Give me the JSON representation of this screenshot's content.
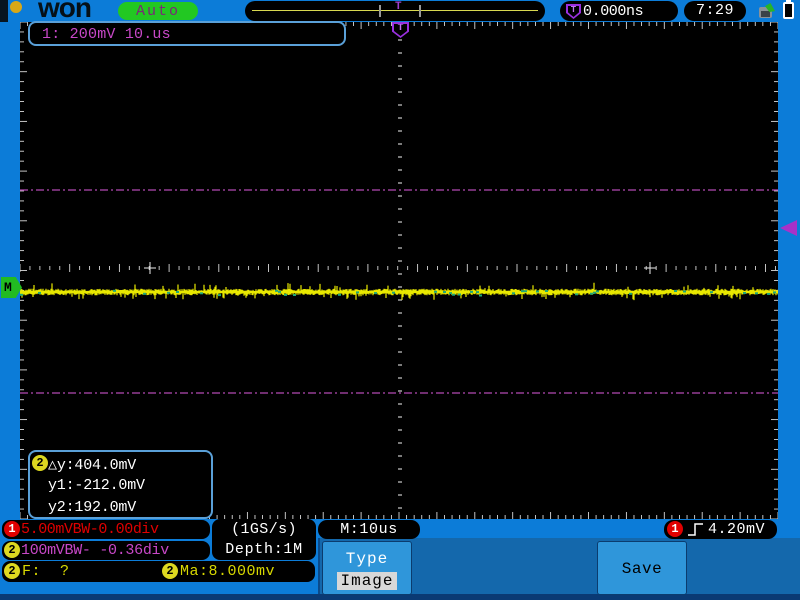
{
  "top_bar": {
    "logo_text": "won",
    "mode": "Auto",
    "trigger_marker": "T",
    "trigger_offset": "0.000ns",
    "clock": "7:29"
  },
  "grid": {
    "channel_info": "1: 200mV 10.us",
    "trigger_marker": "T",
    "math_marker": "M"
  },
  "cursor_measure": {
    "channel_badge": "2",
    "delta_y": "△y:404.0mV",
    "y1": "y1:-212.0mV",
    "y2": "y2:192.0mV"
  },
  "status_bar": {
    "ch1_badge": "1",
    "ch1_info": "5.00mVBW-0.00div",
    "ch2_badge": "2",
    "ch2_info": "100mVBW- -0.36div",
    "freq_badge": "2",
    "freq_info": "F:  ?",
    "ma_badge": "2",
    "ma_info": "Ma:8.000mv",
    "sample_rate": "(1GS/s)",
    "depth": "Depth:1M",
    "timebase": "M:10us",
    "trigger_badge": "1",
    "trigger_level": "4.20mV"
  },
  "menu": {
    "type_label": "Type",
    "type_value": "Image",
    "save_label": "Save"
  },
  "colors": {
    "background_blue": "#0c7cd8",
    "menu_blue": "#1468ac",
    "button_blue": "#2f96da",
    "ch1_color": "#e00000",
    "ch2_color": "#c848c8",
    "trace_color": "#e8e800",
    "auto_pill_green": "#22c822",
    "cursor_line": "#b44ab4"
  }
}
